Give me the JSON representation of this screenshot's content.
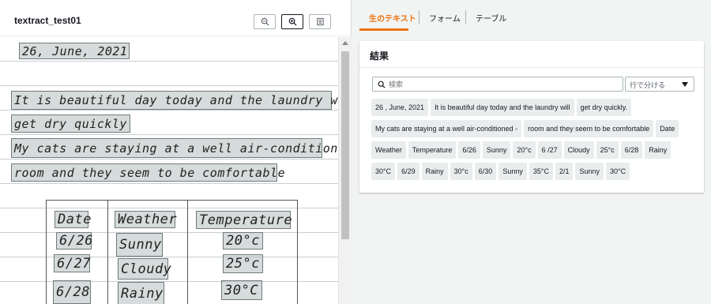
{
  "document": {
    "title": "textract_test01",
    "handwriting": {
      "date_line": "26, June, 2021",
      "line1": "It is beautiful day today and the laundry will",
      "line2": "get dry quickly",
      "line3": "My cats are staying at a well air-conditioned",
      "line4": "room and they seem to be comfortable",
      "headers": [
        "Date",
        "Weather",
        "Temperature"
      ],
      "rows": [
        [
          "6/26",
          "Sunny",
          "20°c"
        ],
        [
          "6/27",
          "Cloudy",
          "25°c"
        ],
        [
          "6/28",
          "Rainy",
          "30°C"
        ]
      ]
    }
  },
  "tabs": [
    {
      "label": "生のテキスト",
      "active": true
    },
    {
      "label": "フォーム",
      "active": false
    },
    {
      "label": "テーブル",
      "active": false
    }
  ],
  "results": {
    "title": "結果",
    "search_placeholder": "検索",
    "select_value": "行で分ける",
    "chip_rows": [
      [
        "26 , June, 2021",
        "It is beautiful day today and the laundry will",
        "get dry quickly."
      ],
      [
        "My cats are staying at a well air-conditioned -",
        "room and they seem to be comfortable",
        "Date"
      ],
      [
        "Weather",
        "Temperature",
        "6/26",
        "Sunny",
        "20°c",
        "6 /27",
        "Cloudy",
        "25°c",
        "6/28",
        "Rainy"
      ],
      [
        "30°C",
        "6/29",
        "Rainy",
        "30°c",
        "6/30",
        "Sunny",
        "35°C",
        "2/1",
        "Sunny",
        "30°C"
      ]
    ]
  },
  "colors": {
    "accent": "#ec7211",
    "chip_bg": "#eaeded"
  }
}
